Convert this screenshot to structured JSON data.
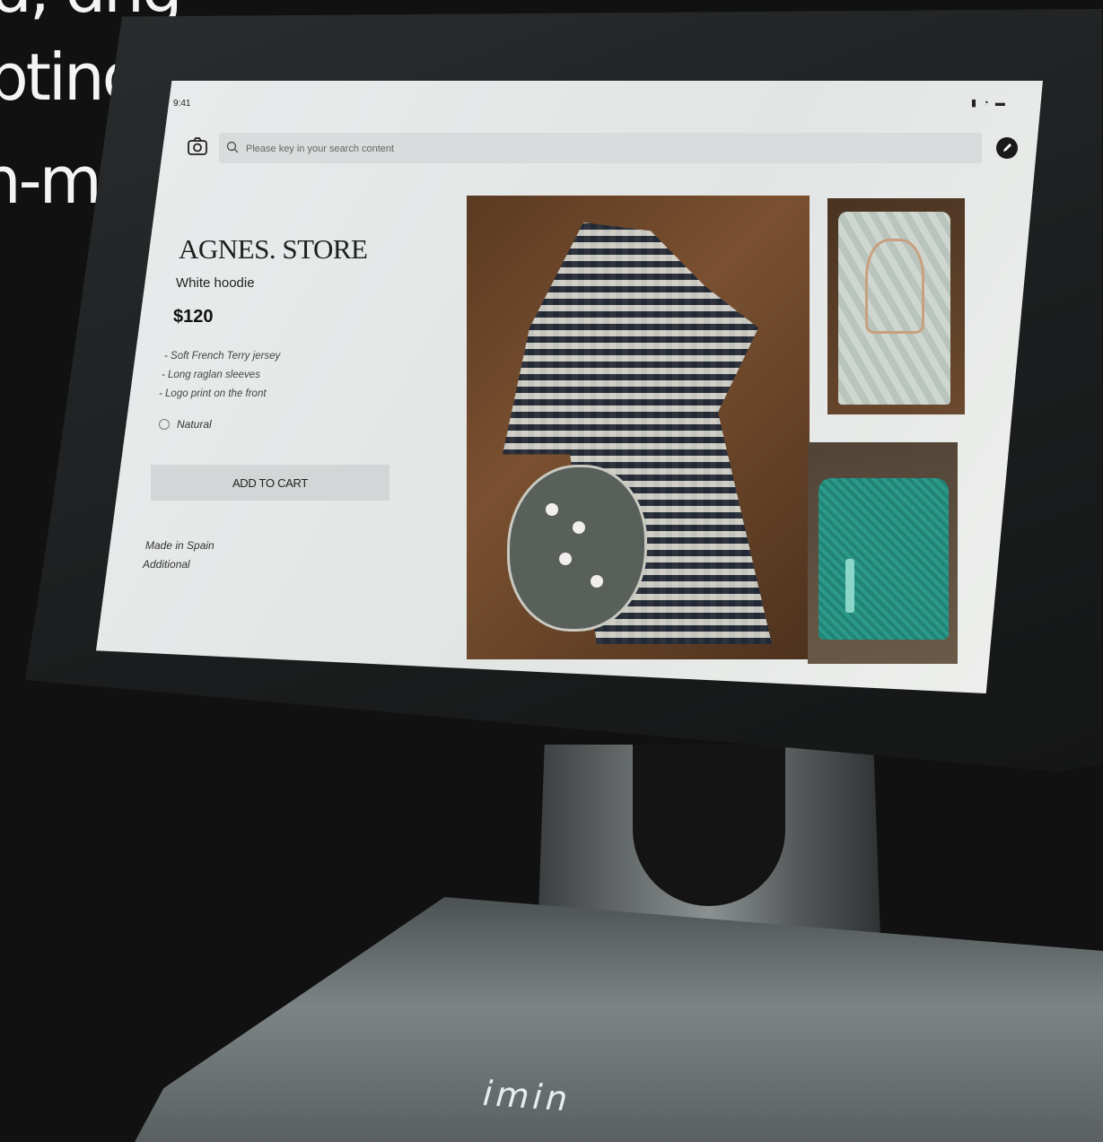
{
  "headline": {
    "line0": "ɑ, ɑnɡ",
    "line1": "pting to",
    "line2": "n-making."
  },
  "status_bar": {
    "time": "9:41",
    "icons": "signal-icon wifi-icon battery-icon"
  },
  "search": {
    "placeholder": "Please key in your search content"
  },
  "store": {
    "name": "AGNES. STORE",
    "product": "White hoodie",
    "price": "$120",
    "features": [
      "- Soft French Terry jersey",
      "- Long raglan sleeves",
      "- Logo  print on the front"
    ],
    "color_option": "Natural",
    "add_to_cart": "ADD TO CART",
    "made_in": "Made in Spain",
    "additional": "Additional"
  },
  "images": [
    {
      "name": "main-product-image",
      "subject": "checkered qipao with fan"
    },
    {
      "name": "thumbnail-light-qipao",
      "subject": "light patterned qipao"
    },
    {
      "name": "thumbnail-teal-qipao",
      "subject": "teal qipao"
    }
  ],
  "device": {
    "brand": "imin"
  },
  "colors": {
    "background": "#111111",
    "screen": "#e6e9e8",
    "button": "#d3d6d6"
  }
}
